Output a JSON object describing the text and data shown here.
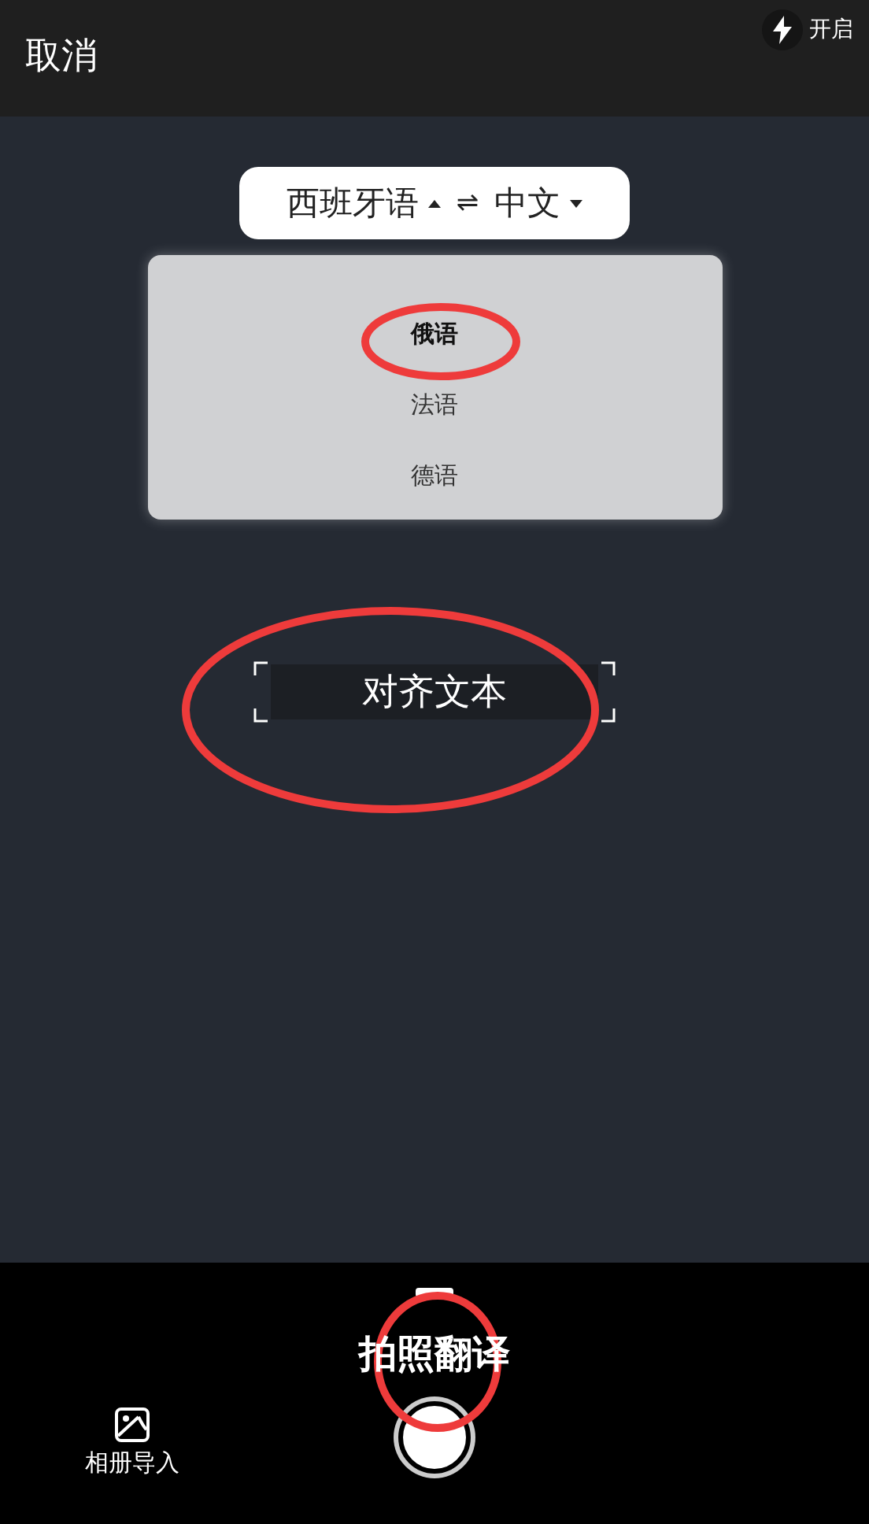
{
  "header": {
    "cancel": "取消",
    "flash": {
      "label": "开启",
      "on": true
    }
  },
  "language_selector": {
    "source": "西班牙语",
    "swap": "⇌",
    "target": "中文",
    "source_open": true
  },
  "language_menu": {
    "items": [
      {
        "label": "俄语",
        "selected": true
      },
      {
        "label": "法语",
        "selected": false
      },
      {
        "label": "德语",
        "selected": false
      }
    ]
  },
  "viewfinder": {
    "hint": "对齐文本"
  },
  "bottom_bar": {
    "mode": "拍照翻译",
    "album": "相册导入"
  },
  "annotations": [
    {
      "kind": "ellipse"
    },
    {
      "kind": "ellipse"
    },
    {
      "kind": "ellipse"
    }
  ]
}
